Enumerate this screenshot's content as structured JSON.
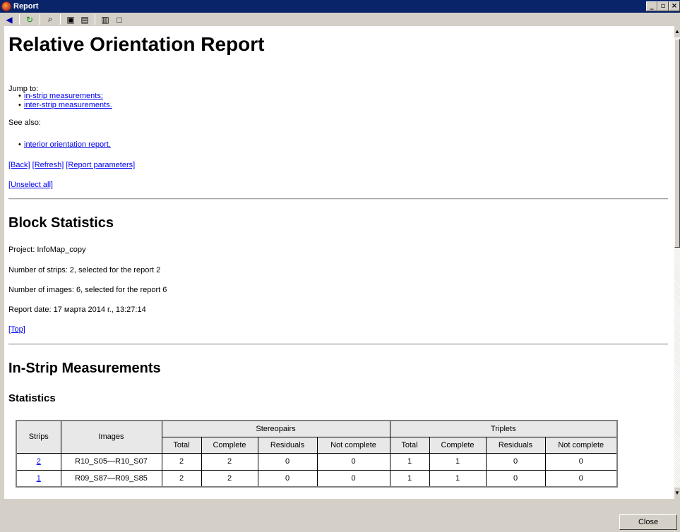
{
  "window": {
    "title": "Report"
  },
  "toolbar": [
    "back-arrow-icon",
    "refresh-icon",
    "find-icon",
    "save-icon",
    "export-icon",
    "print-icon",
    "print-preview-icon"
  ],
  "report": {
    "title": "Relative Orientation Report",
    "jump_to": "Jump to:",
    "jump_links": [
      "in-strip measurements;",
      "inter-strip measurements."
    ],
    "see_also": "See also:",
    "see_also_links": [
      "interior orientation report."
    ],
    "nav_links": [
      "[Back]",
      "[Refresh]",
      "[Report parameters]"
    ],
    "unselect": "[Unselect all]",
    "block_statistics": {
      "heading": "Block Statistics",
      "project": "Project: InfoMap_copy",
      "strips": "Number of strips: 2, selected for the report 2",
      "images": "Number of images: 6, selected for the report 6",
      "report_date": "Report date: 17 марта 2014 г., 13:27:14",
      "top": "[Top]"
    },
    "in_strip": {
      "heading": "In-Strip Measurements",
      "subheading": "Statistics",
      "table": {
        "headers": [
          "Strips",
          "Images",
          "Stereopairs",
          "Triplets"
        ],
        "subheaders": [
          "Total",
          "Complete",
          "Residuals",
          "Not complete",
          "Total",
          "Complete",
          "Residuals",
          "Not complete"
        ],
        "rows": [
          [
            "2",
            "R10_S05—R10_S07",
            "2",
            "2",
            "0",
            "0",
            "1",
            "1",
            "0",
            "0"
          ],
          [
            "1",
            "R09_S87—R09_S85",
            "2",
            "2",
            "0",
            "0",
            "1",
            "1",
            "0",
            "0"
          ]
        ]
      }
    }
  },
  "bottom": {
    "close_label": "Close"
  }
}
